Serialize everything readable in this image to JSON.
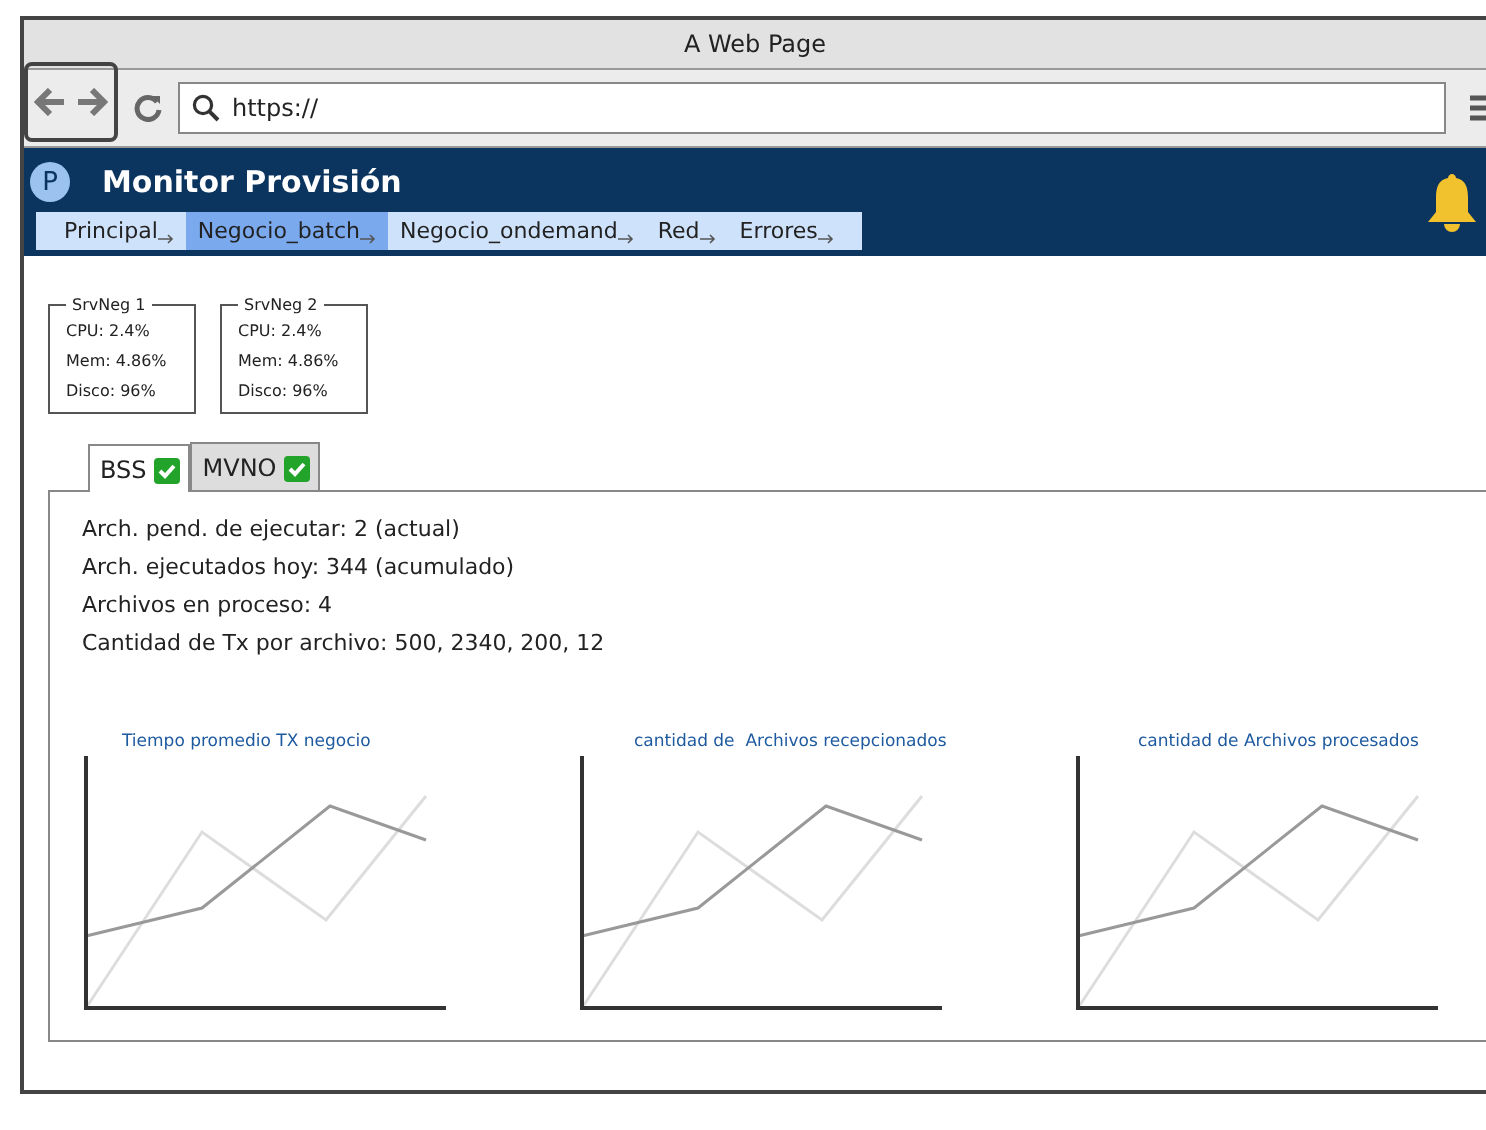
{
  "window": {
    "title": "A Web Page"
  },
  "browser": {
    "url": "https://"
  },
  "header": {
    "logo": "P",
    "title": "Monitor Provisión"
  },
  "nav": [
    {
      "label": "Principal",
      "selected": false
    },
    {
      "label": "Negocio_batch",
      "selected": true
    },
    {
      "label": "Negocio_ondemand",
      "selected": false
    },
    {
      "label": "Red",
      "selected": false
    },
    {
      "label": "Errores",
      "selected": false
    }
  ],
  "servers": [
    {
      "name": "SrvNeg 1",
      "lines": [
        "CPU: 2.4%",
        "Mem: 4.86%",
        "Disco: 96%"
      ]
    },
    {
      "name": "SrvNeg 2",
      "lines": [
        "CPU: 2.4%",
        "Mem: 4.86%",
        "Disco: 96%"
      ]
    }
  ],
  "tabs": [
    {
      "label": "BSS",
      "selected": true
    },
    {
      "label": "MVNO",
      "selected": false
    }
  ],
  "stats": [
    "Arch. pend. de ejecutar: 2 (actual)",
    "Arch. ejecutados hoy: 344 (acumulado)",
    "Archivos en proceso: 4",
    "Cantidad de Tx por archivo: 500, 2340, 200, 12"
  ],
  "charts": [
    {
      "title": "Tiempo promedio TX negocio"
    },
    {
      "title": "cantidad de  Archivos recepcionados"
    },
    {
      "title": "cantidad de Archivos procesados"
    }
  ]
}
